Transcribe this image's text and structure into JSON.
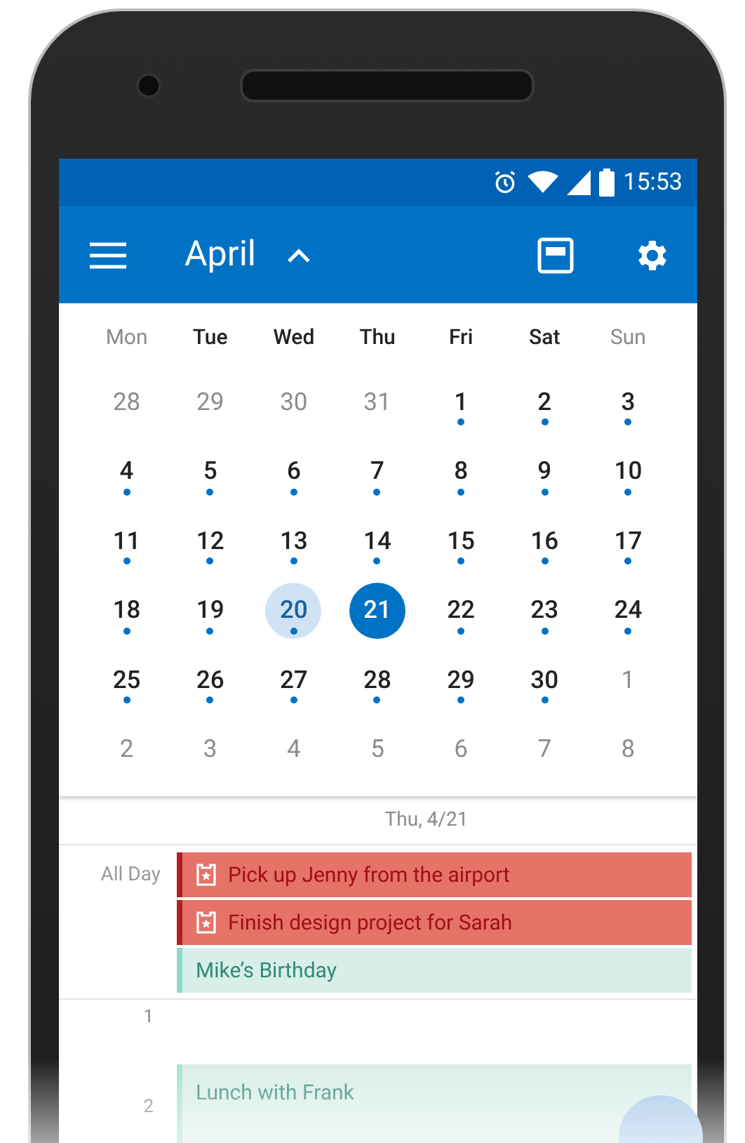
{
  "status_bar": {
    "time": "15:53"
  },
  "app_bar": {
    "title": "April"
  },
  "weekdays": [
    {
      "label": "Mon",
      "muted": true
    },
    {
      "label": "Tue",
      "muted": false
    },
    {
      "label": "Wed",
      "muted": false
    },
    {
      "label": "Thu",
      "muted": false
    },
    {
      "label": "Fri",
      "muted": false
    },
    {
      "label": "Sat",
      "muted": false
    },
    {
      "label": "Sun",
      "muted": true
    }
  ],
  "weeks": [
    [
      {
        "label": "28",
        "other_month": true,
        "has_events": false,
        "selected": false,
        "highlighted": false
      },
      {
        "label": "29",
        "other_month": true,
        "has_events": false,
        "selected": false,
        "highlighted": false
      },
      {
        "label": "30",
        "other_month": true,
        "has_events": false,
        "selected": false,
        "highlighted": false
      },
      {
        "label": "31",
        "other_month": true,
        "has_events": false,
        "selected": false,
        "highlighted": false
      },
      {
        "label": "1",
        "other_month": false,
        "has_events": true,
        "selected": false,
        "highlighted": false
      },
      {
        "label": "2",
        "other_month": false,
        "has_events": true,
        "selected": false,
        "highlighted": false
      },
      {
        "label": "3",
        "other_month": false,
        "has_events": true,
        "selected": false,
        "highlighted": false
      }
    ],
    [
      {
        "label": "4",
        "other_month": false,
        "has_events": true,
        "selected": false,
        "highlighted": false
      },
      {
        "label": "5",
        "other_month": false,
        "has_events": true,
        "selected": false,
        "highlighted": false
      },
      {
        "label": "6",
        "other_month": false,
        "has_events": true,
        "selected": false,
        "highlighted": false
      },
      {
        "label": "7",
        "other_month": false,
        "has_events": true,
        "selected": false,
        "highlighted": false
      },
      {
        "label": "8",
        "other_month": false,
        "has_events": true,
        "selected": false,
        "highlighted": false
      },
      {
        "label": "9",
        "other_month": false,
        "has_events": true,
        "selected": false,
        "highlighted": false
      },
      {
        "label": "10",
        "other_month": false,
        "has_events": true,
        "selected": false,
        "highlighted": false
      }
    ],
    [
      {
        "label": "11",
        "other_month": false,
        "has_events": true,
        "selected": false,
        "highlighted": false
      },
      {
        "label": "12",
        "other_month": false,
        "has_events": true,
        "selected": false,
        "highlighted": false
      },
      {
        "label": "13",
        "other_month": false,
        "has_events": true,
        "selected": false,
        "highlighted": false
      },
      {
        "label": "14",
        "other_month": false,
        "has_events": true,
        "selected": false,
        "highlighted": false
      },
      {
        "label": "15",
        "other_month": false,
        "has_events": true,
        "selected": false,
        "highlighted": false
      },
      {
        "label": "16",
        "other_month": false,
        "has_events": true,
        "selected": false,
        "highlighted": false
      },
      {
        "label": "17",
        "other_month": false,
        "has_events": true,
        "selected": false,
        "highlighted": false
      }
    ],
    [
      {
        "label": "18",
        "other_month": false,
        "has_events": true,
        "selected": false,
        "highlighted": false
      },
      {
        "label": "19",
        "other_month": false,
        "has_events": true,
        "selected": false,
        "highlighted": false
      },
      {
        "label": "20",
        "other_month": false,
        "has_events": true,
        "selected": false,
        "highlighted": true
      },
      {
        "label": "21",
        "other_month": false,
        "has_events": false,
        "selected": true,
        "highlighted": false
      },
      {
        "label": "22",
        "other_month": false,
        "has_events": true,
        "selected": false,
        "highlighted": false
      },
      {
        "label": "23",
        "other_month": false,
        "has_events": true,
        "selected": false,
        "highlighted": false
      },
      {
        "label": "24",
        "other_month": false,
        "has_events": true,
        "selected": false,
        "highlighted": false
      }
    ],
    [
      {
        "label": "25",
        "other_month": false,
        "has_events": true,
        "selected": false,
        "highlighted": false
      },
      {
        "label": "26",
        "other_month": false,
        "has_events": true,
        "selected": false,
        "highlighted": false
      },
      {
        "label": "27",
        "other_month": false,
        "has_events": true,
        "selected": false,
        "highlighted": false
      },
      {
        "label": "28",
        "other_month": false,
        "has_events": true,
        "selected": false,
        "highlighted": false
      },
      {
        "label": "29",
        "other_month": false,
        "has_events": true,
        "selected": false,
        "highlighted": false
      },
      {
        "label": "30",
        "other_month": false,
        "has_events": true,
        "selected": false,
        "highlighted": false
      },
      {
        "label": "1",
        "other_month": true,
        "has_events": false,
        "selected": false,
        "highlighted": false
      }
    ],
    [
      {
        "label": "2",
        "other_month": true,
        "has_events": false,
        "selected": false,
        "highlighted": false
      },
      {
        "label": "3",
        "other_month": true,
        "has_events": false,
        "selected": false,
        "highlighted": false
      },
      {
        "label": "4",
        "other_month": true,
        "has_events": false,
        "selected": false,
        "highlighted": false
      },
      {
        "label": "5",
        "other_month": true,
        "has_events": false,
        "selected": false,
        "highlighted": false
      },
      {
        "label": "6",
        "other_month": true,
        "has_events": false,
        "selected": false,
        "highlighted": false
      },
      {
        "label": "7",
        "other_month": true,
        "has_events": false,
        "selected": false,
        "highlighted": false
      },
      {
        "label": "8",
        "other_month": true,
        "has_events": false,
        "selected": false,
        "highlighted": false
      }
    ]
  ],
  "agenda": {
    "date": "Thu, 4/21",
    "all_day_label": "All Day",
    "all_day_events": [
      {
        "title": "Pick up Jenny from the airport",
        "kind": "task",
        "color": "#e57368"
      },
      {
        "title": "Finish design project for Sarah",
        "kind": "task",
        "color": "#e57368"
      },
      {
        "title": "Mike’s Birthday",
        "kind": "event",
        "color": "#d9eee9"
      }
    ],
    "hours": [
      {
        "label": "1"
      },
      {
        "label": "2"
      }
    ],
    "timed_events": [
      {
        "title": "Lunch with Frank",
        "color": "#d9eee9"
      }
    ]
  }
}
